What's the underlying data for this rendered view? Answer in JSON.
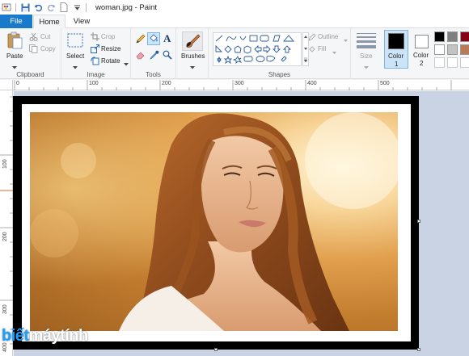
{
  "titlebar": {
    "title": "woman.jpg - Paint"
  },
  "tabs": {
    "file": "File",
    "home": "Home",
    "view": "View"
  },
  "clipboard": {
    "paste": "Paste",
    "cut": "Cut",
    "copy": "Copy",
    "label": "Clipboard"
  },
  "image": {
    "select": "Select",
    "crop": "Crop",
    "resize": "Resize",
    "rotate": "Rotate",
    "label": "Image"
  },
  "tools": {
    "label": "Tools"
  },
  "brushes": {
    "label": "Brushes"
  },
  "shapes": {
    "outline": "Outline",
    "fill": "Fill",
    "label": "Shapes"
  },
  "size": {
    "label": "Size"
  },
  "colors": {
    "color1_label": "Color\n1",
    "color1_line1": "Color",
    "color1_line2": "1",
    "color2_line1": "Color",
    "color2_line2": "2",
    "color1": "#000000",
    "color2": "#ffffff",
    "palette": [
      "#000000",
      "#7f7f7f",
      "#880015",
      "#ffffff",
      "#c3c3c3",
      "#b97a57"
    ]
  },
  "ruler": {
    "top": [
      "0",
      "100",
      "200",
      "300",
      "400",
      "500"
    ],
    "left": [
      "100",
      "200",
      "300",
      "400"
    ]
  },
  "watermark": {
    "part1": "biết",
    "part2": "máytính"
  },
  "accent": "#1979ca"
}
